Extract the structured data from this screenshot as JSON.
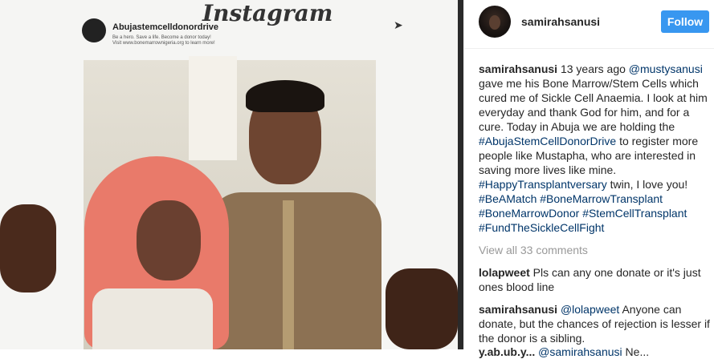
{
  "post": {
    "username": "samirahsanusi",
    "follow_label": "Follow"
  },
  "photo": {
    "frame_logo": "Instagram",
    "frame_account": "Abujastemcelldonordrive",
    "frame_caption_line1": "Be a hero. Save a life. Become a donor today!",
    "frame_caption_line2": "Visit www.bonemarrownigeria.org to learn more!"
  },
  "caption": {
    "username": "samirahsanusi",
    "text_1": " 13 years ago ",
    "mention_1": "@mustysanusi",
    "text_2": " gave me his Bone Marrow/Stem Cells which cured me of Sickle Cell Anaemia. I look at him everyday and thank God for him, and for a cure. Today in Abuja we are holding the ",
    "hashtag_1": "#AbujaStemCellDonorDrive",
    "text_3": " to register more people like Mustapha, who are interested in saving more lives like mine. ",
    "hashtag_2": "#HappyTransplantversary",
    "text_4": " twin, I love you! ",
    "hashtag_3": "#BeAMatch",
    "hashtag_4": "#BoneMarrowTransplant",
    "hashtag_5": "#BoneMarrowDonor",
    "hashtag_6": "#StemCellTransplant",
    "hashtag_7": "#FundTheSickleCellFight"
  },
  "view_all": "View all 33 comments",
  "comments": [
    {
      "username": "lolapweet",
      "text": " Pls can any one donate or it's just ones blood line"
    },
    {
      "username": "samirahsanusi",
      "mention": "@lolapweet",
      "text": " Anyone can donate, but the chances of rejection is lesser if the donor is a sibling."
    }
  ],
  "partial_comment": {
    "username": "y.ab.ub.y...",
    "mention": "@samirahsanusi",
    "text": " Ne..."
  }
}
